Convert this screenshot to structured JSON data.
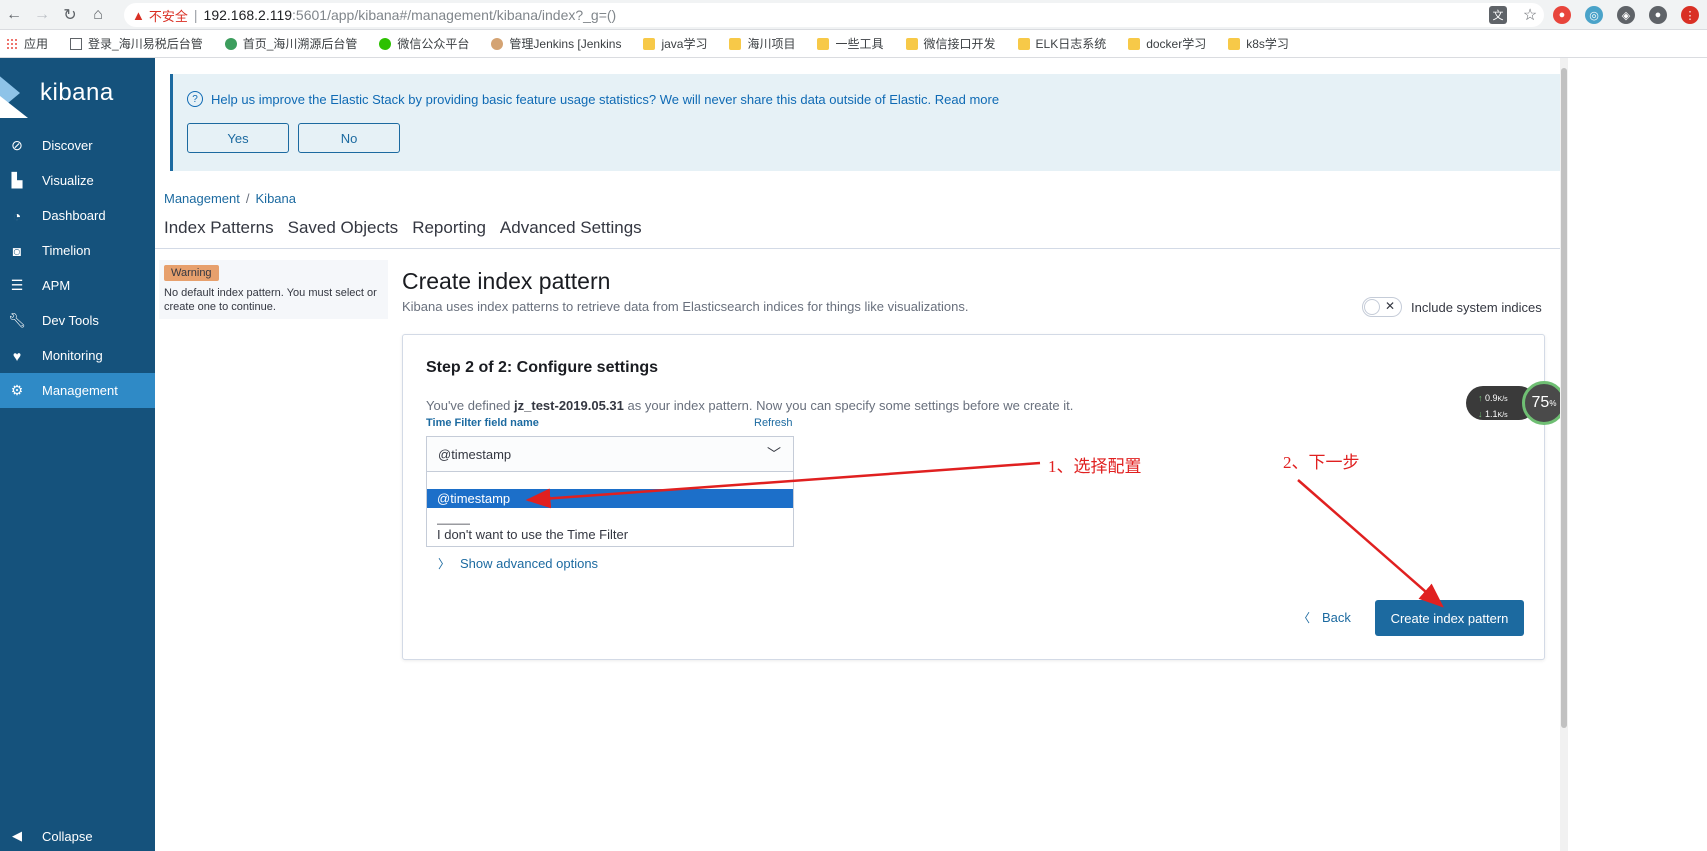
{
  "browser": {
    "insecure_label": "不安全",
    "url_host": "192.168.2.119",
    "url_path": ":5601/app/kibana#/management/kibana/index?_g=()",
    "bookmarks": [
      {
        "label": "应用",
        "icon": "apps-icon"
      },
      {
        "label": "登录_海川易税后台管",
        "icon": "page-icon"
      },
      {
        "label": "首页_海川溯源后台管",
        "icon": "site-icon"
      },
      {
        "label": "微信公众平台",
        "icon": "wechat-icon"
      },
      {
        "label": "管理Jenkins [Jenkins",
        "icon": "jenkins-icon"
      },
      {
        "label": "java学习",
        "icon": "folder-icon"
      },
      {
        "label": "海川项目",
        "icon": "folder-icon"
      },
      {
        "label": "一些工具",
        "icon": "folder-icon"
      },
      {
        "label": "微信接口开发",
        "icon": "folder-icon"
      },
      {
        "label": "ELK日志系统",
        "icon": "folder-icon"
      },
      {
        "label": "docker学习",
        "icon": "folder-icon"
      },
      {
        "label": "k8s学习",
        "icon": "folder-icon"
      }
    ]
  },
  "sidebar": {
    "logo": "kibana",
    "items": [
      {
        "label": "Discover",
        "icon": "compass-icon"
      },
      {
        "label": "Visualize",
        "icon": "bar-chart-icon"
      },
      {
        "label": "Dashboard",
        "icon": "dashboard-icon"
      },
      {
        "label": "Timelion",
        "icon": "timelion-icon"
      },
      {
        "label": "APM",
        "icon": "apm-icon"
      },
      {
        "label": "Dev Tools",
        "icon": "wrench-icon"
      },
      {
        "label": "Monitoring",
        "icon": "heartbeat-icon"
      },
      {
        "label": "Management",
        "icon": "gear-icon"
      }
    ],
    "collapse_label": "Collapse"
  },
  "banner": {
    "text": "Help us improve the Elastic Stack by providing basic feature usage statistics? We will never share this data outside of Elastic. Read more",
    "yes_label": "Yes",
    "no_label": "No"
  },
  "breadcrumb": {
    "parent": "Management",
    "sep": "/",
    "current": "Kibana"
  },
  "tabs": [
    "Index Patterns",
    "Saved Objects",
    "Reporting",
    "Advanced Settings"
  ],
  "warning": {
    "badge": "Warning",
    "text": "No default index pattern. You must select or create one to continue."
  },
  "page": {
    "title": "Create index pattern",
    "subtitle": "Kibana uses index patterns to retrieve data from Elasticsearch indices for things like visualizations.",
    "toggle_label": "Include system indices"
  },
  "card": {
    "title": "Step 2 of 2: Configure settings",
    "desc_prefix": "You've defined ",
    "pattern": "jz_test-2019.05.31",
    "desc_suffix": " as your index pattern. Now you can specify some settings before we create it.",
    "field_label": "Time Filter field name",
    "refresh": "Refresh",
    "selected_value": "@timestamp",
    "options": [
      "@timestamp",
      "———",
      "I don't want to use the Time Filter"
    ],
    "advanced": "Show advanced options",
    "back": "Back",
    "create": "Create index pattern"
  },
  "speed_widget": {
    "up": "0.9",
    "down": "1.1",
    "unit": "K/s",
    "percent": "75",
    "percent_sign": "%"
  },
  "annotations": {
    "step1": "1、选择配置",
    "step2": "2、下一步"
  },
  "colors": {
    "sidebar": "#15527c",
    "active": "#2f8ac6",
    "primary": "#1c6aa0",
    "annotation": "#e02020"
  }
}
